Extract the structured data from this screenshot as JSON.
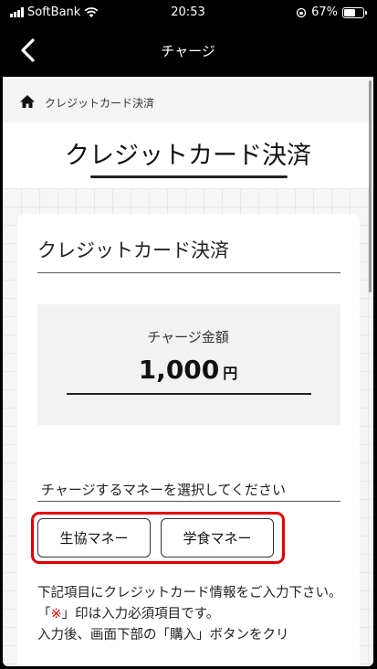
{
  "status_bar": {
    "carrier": "SoftBank",
    "time": "20:53",
    "battery": "67%",
    "battery_level": 0.67
  },
  "nav": {
    "title": "チャージ"
  },
  "breadcrumb": {
    "label": "クレジットカード決済"
  },
  "page": {
    "title": "クレジットカード決済"
  },
  "card": {
    "title": "クレジットカード決済",
    "amount_label": "チャージ金額",
    "amount_value": "1,000",
    "amount_unit": "円",
    "select_label": "チャージするマネーを選択してください",
    "buttons": [
      "生協マネー",
      "学食マネー"
    ],
    "info": {
      "line1": "下記項目にクレジットカード情報をご入力下さい。",
      "req_open": "「",
      "req_mark": "※",
      "req_close": "」印は入力必須項目です。",
      "line3": "入力後、画面下部の「購入」ボタンをクリ"
    }
  },
  "colors": {
    "accent_red": "#e10000",
    "navbar": "#000000"
  }
}
